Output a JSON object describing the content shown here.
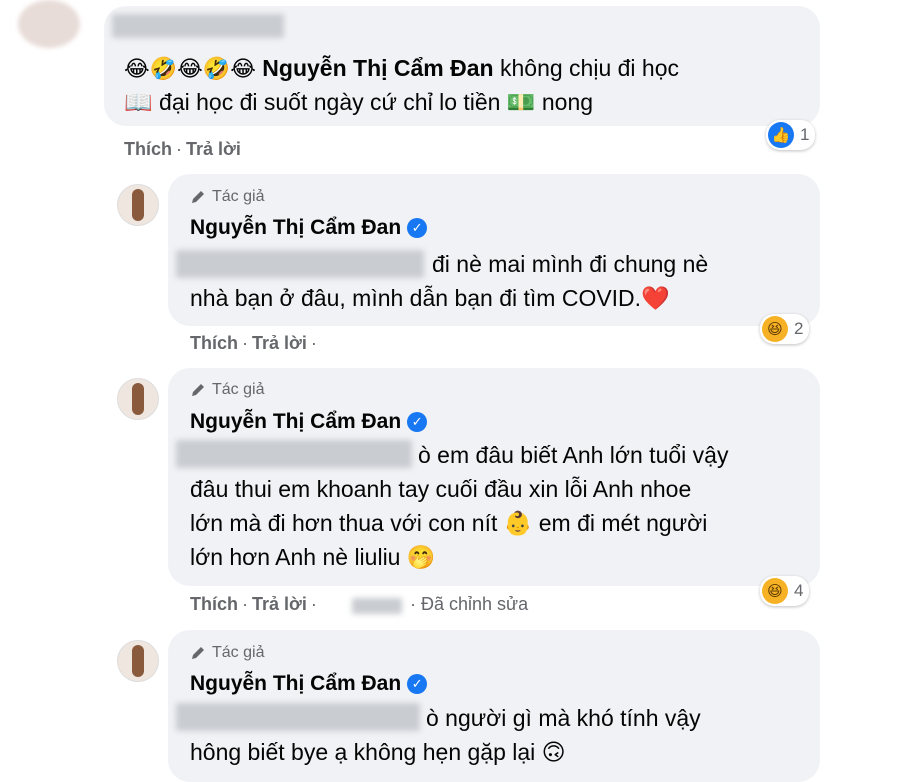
{
  "comments": [
    {
      "emoji_prefix": "😂🤣😂🤣😂",
      "author": "Nguyễn Thị Cẩm Đan",
      "line1_rest": "không chịu đi học",
      "line2": "📖 đại học đi suốt ngày cứ chỉ lo tiền 💵 nong",
      "like_label": "Thích",
      "reply_label": "Trả lời",
      "reaction_count": "1",
      "reaction_icon": "like-icon"
    },
    {
      "author_tag": "Tác giả",
      "author": "Nguyễn Thị Cẩm Đan",
      "line1": "đi nè mai mình đi chung nè",
      "line2": "nhà bạn ở đâu, mình dẫn bạn đi tìm COVID.❤️",
      "like_label": "Thích",
      "reply_label": "Trả lời",
      "reaction_count": "2",
      "reaction_icon": "haha-icon"
    },
    {
      "author_tag": "Tác giả",
      "author": "Nguyễn Thị Cẩm Đan",
      "line1": "ò em đâu biết Anh lớn tuổi vậy",
      "line2": "đâu thui em khoanh tay cuối đầu xin lỗi Anh nhoe",
      "line3": "lớn mà đi hơn thua với con nít 👶 em đi mét người",
      "line4": "lớn hơn Anh nè liuliu 🤭",
      "like_label": "Thích",
      "reply_label": "Trả lời",
      "edited_label": "· Đã chỉnh sửa",
      "reaction_count": "4",
      "reaction_icon": "haha-icon"
    },
    {
      "author_tag": "Tác giả",
      "author": "Nguyễn Thị Cẩm Đan",
      "line1": "ò người gì mà khó tính vậy",
      "line2": "hông biết bye ạ không hẹn gặp lại 🙃"
    }
  ],
  "colors": {
    "bubble": "#f0f2f5",
    "meta_text": "#65676b",
    "verified_blue": "#1877f2"
  }
}
